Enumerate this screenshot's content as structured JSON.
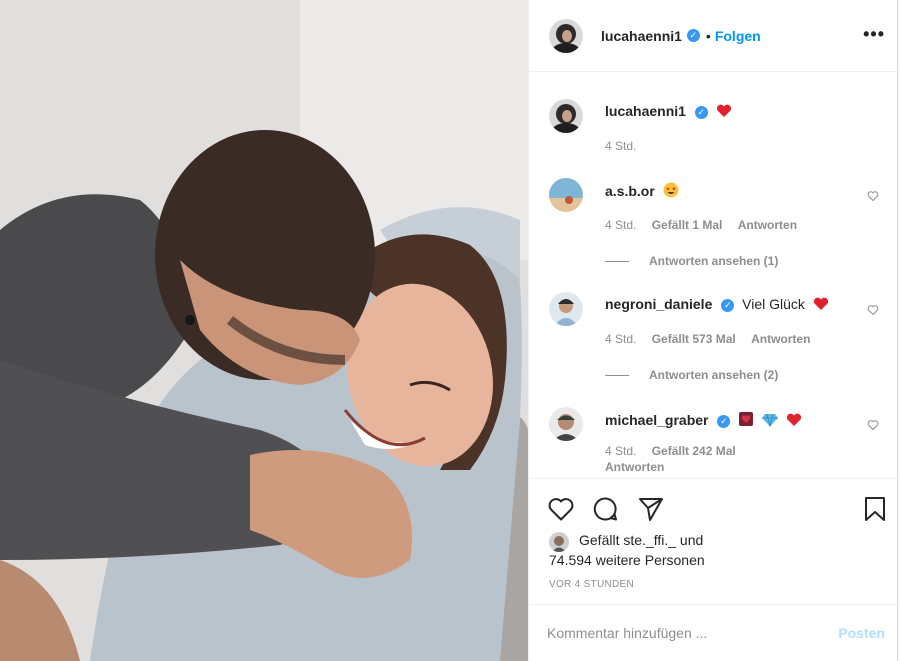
{
  "post": {
    "author": "lucahaenni1",
    "follow_label": "Folgen",
    "dot": "•",
    "more_label": "•••"
  },
  "caption": {
    "user": "lucahaenni1",
    "time": "4 Std."
  },
  "comments": [
    {
      "user": "a.s.b.or",
      "text": "",
      "emojis": [
        "star-struck-emoji"
      ],
      "time": "4 Std.",
      "likes": "Gefällt 1 Mal",
      "reply_label": "Antworten",
      "view_replies": "Antworten ansehen (1)"
    },
    {
      "user": "negroni_daniele",
      "text": "Viel Glück",
      "emojis": [
        "red-heart-emoji"
      ],
      "time": "4 Std.",
      "likes": "Gefällt 573 Mal",
      "reply_label": "Antworten",
      "view_replies": "Antworten ansehen (2)"
    },
    {
      "user": "michael_graber",
      "text": "",
      "emojis": [
        "heart-decoration-emoji",
        "gem-emoji",
        "red-heart-emoji"
      ],
      "time": "4 Std.",
      "likes": "Gefällt 242 Mal",
      "reply_label": "Antworten"
    }
  ],
  "likes": {
    "line1": "Gefällt ste._ffi._ und",
    "line2": "74.594 weitere Personen"
  },
  "timestamp": "Vor 4 Stunden",
  "composer": {
    "placeholder": "Kommentar hinzufügen ...",
    "post_label": "Posten"
  },
  "colors": {
    "accent": "#0095f6",
    "verified": "#3897f0",
    "muted": "#8e8e8e",
    "post_disabled": "#b2dffc"
  },
  "icons": [
    "verified-icon",
    "heart-icon",
    "comment-icon",
    "share-icon",
    "bookmark-icon",
    "more-icon"
  ]
}
